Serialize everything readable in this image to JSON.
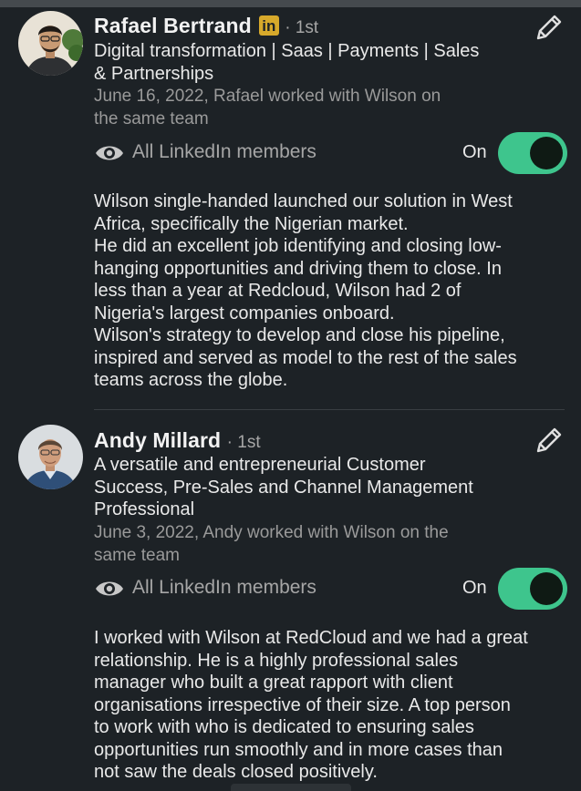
{
  "recommendations": [
    {
      "name": "Rafael Bertrand",
      "badge": "in",
      "degree": "· 1st",
      "headline_lines": [
        "Digital transformation | Saas | Payments | Sales",
        "& Partnerships"
      ],
      "date_lines": [
        "June 16, 2022, Rafael worked with Wilson on",
        "the same team"
      ],
      "visibility_label": "All LinkedIn members",
      "toggle_label": "On",
      "toggle_on": true,
      "text_lines": [
        "Wilson single-handed launched our solution in West",
        "Africa, specifically the Nigerian market.",
        "He did an excellent job identifying and closing low-",
        "hanging opportunities and driving them to close. In",
        "less than a year at Redcloud, Wilson had 2 of",
        "Nigeria's largest companies onboard.",
        "Wilson's strategy to develop and close his pipeline,",
        "inspired and served as model to the rest of the sales",
        "teams across the globe."
      ]
    },
    {
      "name": "Andy Millard",
      "degree": "· 1st",
      "headline_lines": [
        "A versatile and entrepreneurial Customer",
        "Success, Pre-Sales and Channel Management",
        "Professional"
      ],
      "date_lines": [
        "June 3, 2022, Andy worked with Wilson on the",
        "same team"
      ],
      "visibility_label": "All LinkedIn members",
      "toggle_label": "On",
      "toggle_on": true,
      "text_lines": [
        "I worked with Wilson at RedCloud and we had a great",
        "relationship.  He is a highly professional sales",
        "manager who built a great rapport with client",
        "organisations irrespective of their size. A top person",
        "to work with who is dedicated to ensuring sales",
        "opportunities run smoothly and in more cases than",
        "not saw the deals closed positively."
      ]
    }
  ],
  "icons": {
    "edit": "pencil-icon",
    "visibility": "eye-icon",
    "badge": "linkedin-icon"
  },
  "colors": {
    "background": "#1d2226",
    "toggle_on": "#3ec58d",
    "badge": "#d7a92b",
    "secondary_text": "#9a9a9a"
  }
}
